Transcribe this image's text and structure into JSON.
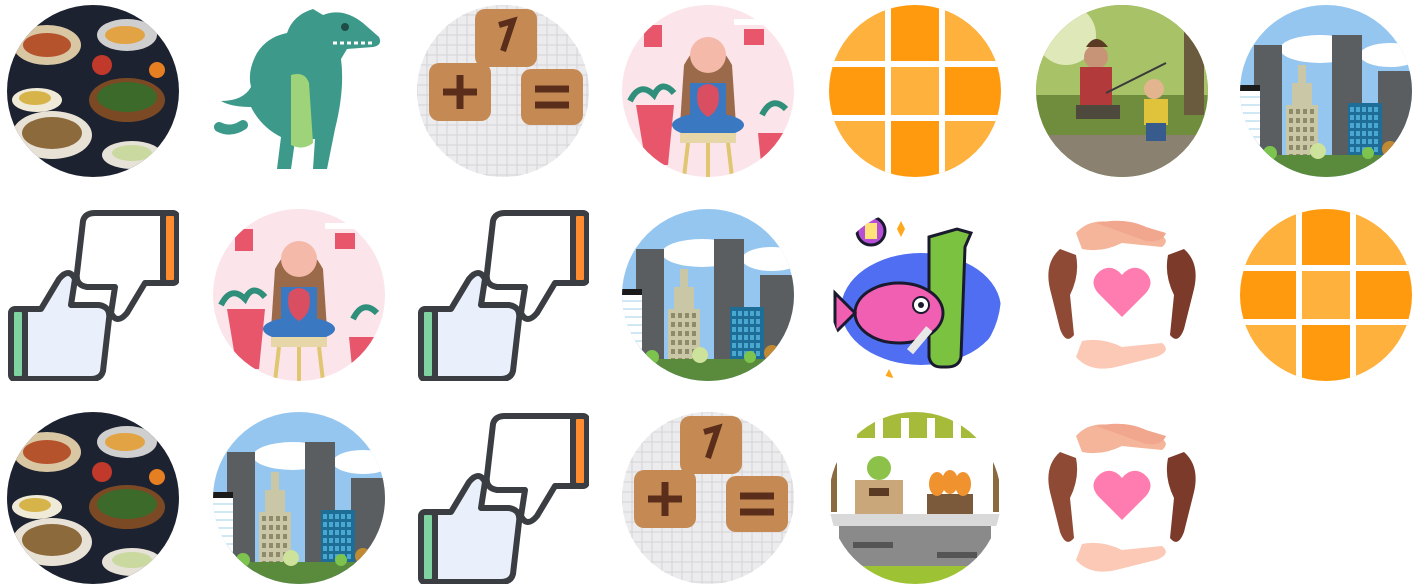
{
  "tiles": [
    {
      "icon": "food-feast-icon"
    },
    {
      "icon": "green-dinosaur-icon"
    },
    {
      "icon": "cookie-math-tiles-icon"
    },
    {
      "icon": "pottery-woman-icon"
    },
    {
      "icon": "orange-grid-icon"
    },
    {
      "icon": "family-hiking-photo-icon"
    },
    {
      "icon": "city-skyline-icon"
    },
    {
      "icon": "thumbs-up-down-icon"
    },
    {
      "icon": "pottery-woman-icon"
    },
    {
      "icon": "thumbs-up-down-icon"
    },
    {
      "icon": "city-skyline-icon"
    },
    {
      "icon": "fish-pollution-icon"
    },
    {
      "icon": "hands-heart-icon"
    },
    {
      "icon": "orange-grid-icon"
    },
    {
      "icon": "food-feast-icon"
    },
    {
      "icon": "city-skyline-icon"
    },
    {
      "icon": "thumbs-up-down-icon"
    },
    {
      "icon": "cookie-math-tiles-icon"
    },
    {
      "icon": "market-stall-icon"
    },
    {
      "icon": "hands-heart-icon"
    }
  ]
}
